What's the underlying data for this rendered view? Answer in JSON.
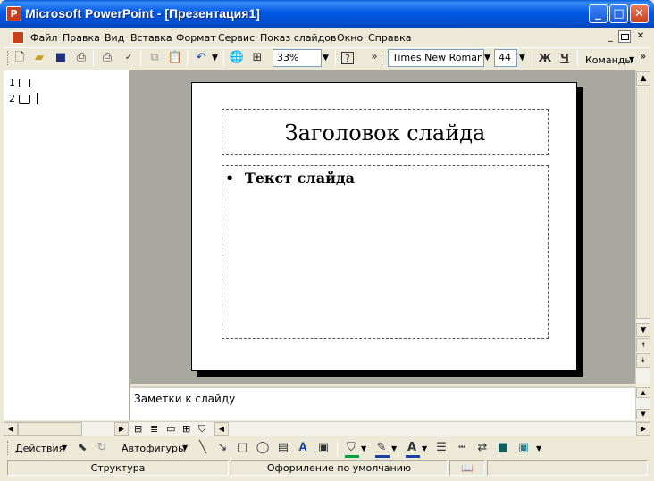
{
  "window": {
    "title": "Microsoft PowerPoint - [Презентация1]",
    "app_icon": "powerpoint-icon",
    "controls": {
      "minimize": "_",
      "maximize": "□",
      "close": "✕"
    }
  },
  "menu": {
    "items": [
      "Файл",
      "Правка",
      "Вид",
      "Вставка",
      "Формат",
      "Сервис",
      "Показ слайдов",
      "Окно",
      "Справка"
    ],
    "doc_controls": {
      "minimize": "_",
      "restore": "🗗",
      "close": "✕"
    }
  },
  "toolbar": {
    "zoom": "33%",
    "font_name": "Times New Roman",
    "font_size": "44",
    "bold": "Ж",
    "underline": "Ч",
    "commands": "Команды",
    "more": "»",
    "help": "?"
  },
  "outline": {
    "slides": [
      {
        "number": "1"
      },
      {
        "number": "2"
      }
    ]
  },
  "slide": {
    "title": "Заголовок слайда",
    "bullet": "•",
    "body_text": "Текст слайда"
  },
  "notes": {
    "placeholder": "Заметки к слайду"
  },
  "drawing": {
    "actions": "Действия",
    "autoshapes": "Автофигуры"
  },
  "status": {
    "view": "Структура",
    "design": "Оформление по умолчанию"
  },
  "colors": {
    "titlebar": "#0058e6",
    "workspace": "#a8a8a0",
    "fill_highlight": "#00a040",
    "line_color": "#1a3fa0",
    "font_color": "#1a3fa0"
  }
}
